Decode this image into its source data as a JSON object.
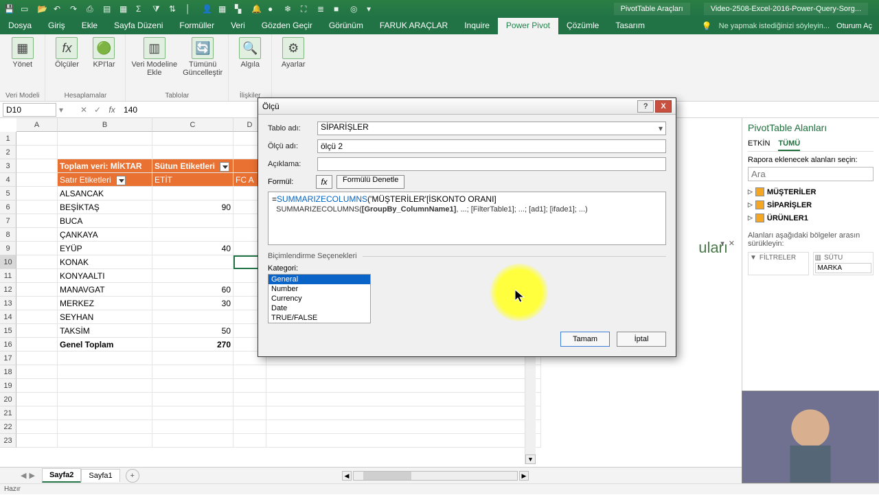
{
  "qat": {
    "tooltip_titles": [
      "save",
      "new",
      "open",
      "print",
      "copy",
      "undo",
      "redo",
      "sum",
      "filter",
      "sort",
      "user",
      "apps",
      "alert",
      "bell",
      "record",
      "star",
      "freeze",
      "list",
      "stop",
      "target"
    ]
  },
  "context_titles": {
    "left": "PivotTable Araçları",
    "right": "Video-2508-Excel-2016-Power-Query-Sorg..."
  },
  "tabs": [
    "Dosya",
    "Giriş",
    "Ekle",
    "Sayfa Düzeni",
    "Formüller",
    "Veri",
    "Gözden Geçir",
    "Görünüm",
    "FARUK ARAÇLAR",
    "Inquire",
    "Power Pivot",
    "Çözümle",
    "Tasarım"
  ],
  "active_tab": "Power Pivot",
  "tell_me": "Ne yapmak istediğinizi söyleyin...",
  "signin": "Oturum Aç",
  "ribbon": {
    "groups": [
      {
        "label": "Veri Modeli",
        "buttons": [
          {
            "name": "Yönet"
          }
        ]
      },
      {
        "label": "Hesaplamalar",
        "buttons": [
          {
            "name": "Ölçüler"
          },
          {
            "name": "KPI'lar"
          }
        ]
      },
      {
        "label": "Tablolar",
        "buttons": [
          {
            "name": "Veri Modeline\nEkle"
          },
          {
            "name": "Tümünü\nGüncelleştir"
          }
        ]
      },
      {
        "label": "İlişkiler",
        "buttons": [
          {
            "name": "Algıla"
          }
        ]
      },
      {
        "label": "",
        "buttons": [
          {
            "name": "Ayarlar"
          }
        ]
      }
    ]
  },
  "namebox": "D10",
  "formula_value": "140",
  "col_headers": [
    "A",
    "B",
    "C",
    "D"
  ],
  "pivot": {
    "title": "Toplam veri: MİKTAR",
    "col_label": "Sütun Etiketleri",
    "row_label": "Satır Etiketleri",
    "col1": "ETİT",
    "col2": "FC A",
    "rows": [
      {
        "name": "ALSANCAK",
        "v": ""
      },
      {
        "name": "BEŞİKTAŞ",
        "v": "90"
      },
      {
        "name": "BUCA",
        "v": ""
      },
      {
        "name": "ÇANKAYA",
        "v": ""
      },
      {
        "name": "EYÜP",
        "v": "40"
      },
      {
        "name": "KONAK",
        "v": ""
      },
      {
        "name": "KONYAALTI",
        "v": ""
      },
      {
        "name": "MANAVGAT",
        "v": "60"
      },
      {
        "name": "MERKEZ",
        "v": "30"
      },
      {
        "name": "SEYHAN",
        "v": ""
      },
      {
        "name": "TAKSİM",
        "v": "50"
      }
    ],
    "total_label": "Genel Toplam",
    "total_value": "270"
  },
  "dialog": {
    "title": "Ölçü",
    "labels": {
      "table": "Tablo adı:",
      "measure": "Ölçü adı:",
      "desc": "Açıklama:",
      "formula": "Formül:",
      "check": "Formülü Denetle",
      "fmt": "Biçimlendirme Seçenekleri",
      "cat": "Kategori:"
    },
    "table_name": "SİPARİŞLER",
    "measure_name": "ölçü 2",
    "description": "",
    "formula": {
      "eq": "=",
      "func": "SUMMARIZECOLUMNS",
      "rest": "('MÜŞTERİLER'[İSKONTO ORANI]"
    },
    "hint": {
      "func": "SUMMARIZECOLUMNS(",
      "arg": "[GroupBy_ColumnName1]",
      "tail": ", ...; [FilterTable1]; ...; [ad1]; [ifade1]; ...)"
    },
    "categories": [
      "General",
      "Number",
      "Currency",
      "Date",
      "TRUE/FALSE"
    ],
    "ok": "Tamam",
    "cancel": "İptal"
  },
  "side": {
    "title": "PivotTable Alanları",
    "tab_active": "ETKİN",
    "tab_all": "TÜMÜ",
    "hint": "Rapora eklenecek alanları seçin:",
    "search": "Ara",
    "fields": [
      "MÜŞTERİLER",
      "SİPARİŞLER",
      "ÜRÜNLER1"
    ],
    "drag": "Alanları aşağıdaki bölgeler arasın sürükleyin:",
    "zone_filter": "FİLTRELER",
    "zone_col": "SÜTU",
    "zone_col_item": "MARKA"
  },
  "slicer_fragment": "uları",
  "sheets": {
    "tabs": [
      "Sayfa2",
      "Sayfa1"
    ],
    "active": "Sayfa2"
  },
  "status": "Hazır"
}
